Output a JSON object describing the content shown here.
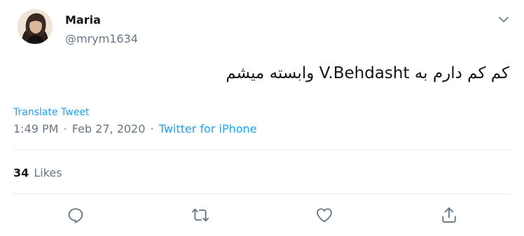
{
  "author": {
    "display_name": "Maria",
    "handle": "@mrym1634"
  },
  "tweet": {
    "text": "کم کم دارم به V.Behdasht وابسته میشم",
    "translate_label": "Translate Tweet",
    "time": "1:49 PM",
    "separator": "·",
    "date": "Feb 27, 2020",
    "source": "Twitter for iPhone"
  },
  "stats": {
    "likes_count": "34",
    "likes_label": "Likes"
  },
  "icons": {
    "more": "chevron-down-icon",
    "reply": "reply-icon",
    "retweet": "retweet-icon",
    "like": "heart-icon",
    "share": "share-icon"
  },
  "colors": {
    "accent": "#1da1f2",
    "secondary_text": "#657786",
    "divider": "#e6ecf0"
  }
}
